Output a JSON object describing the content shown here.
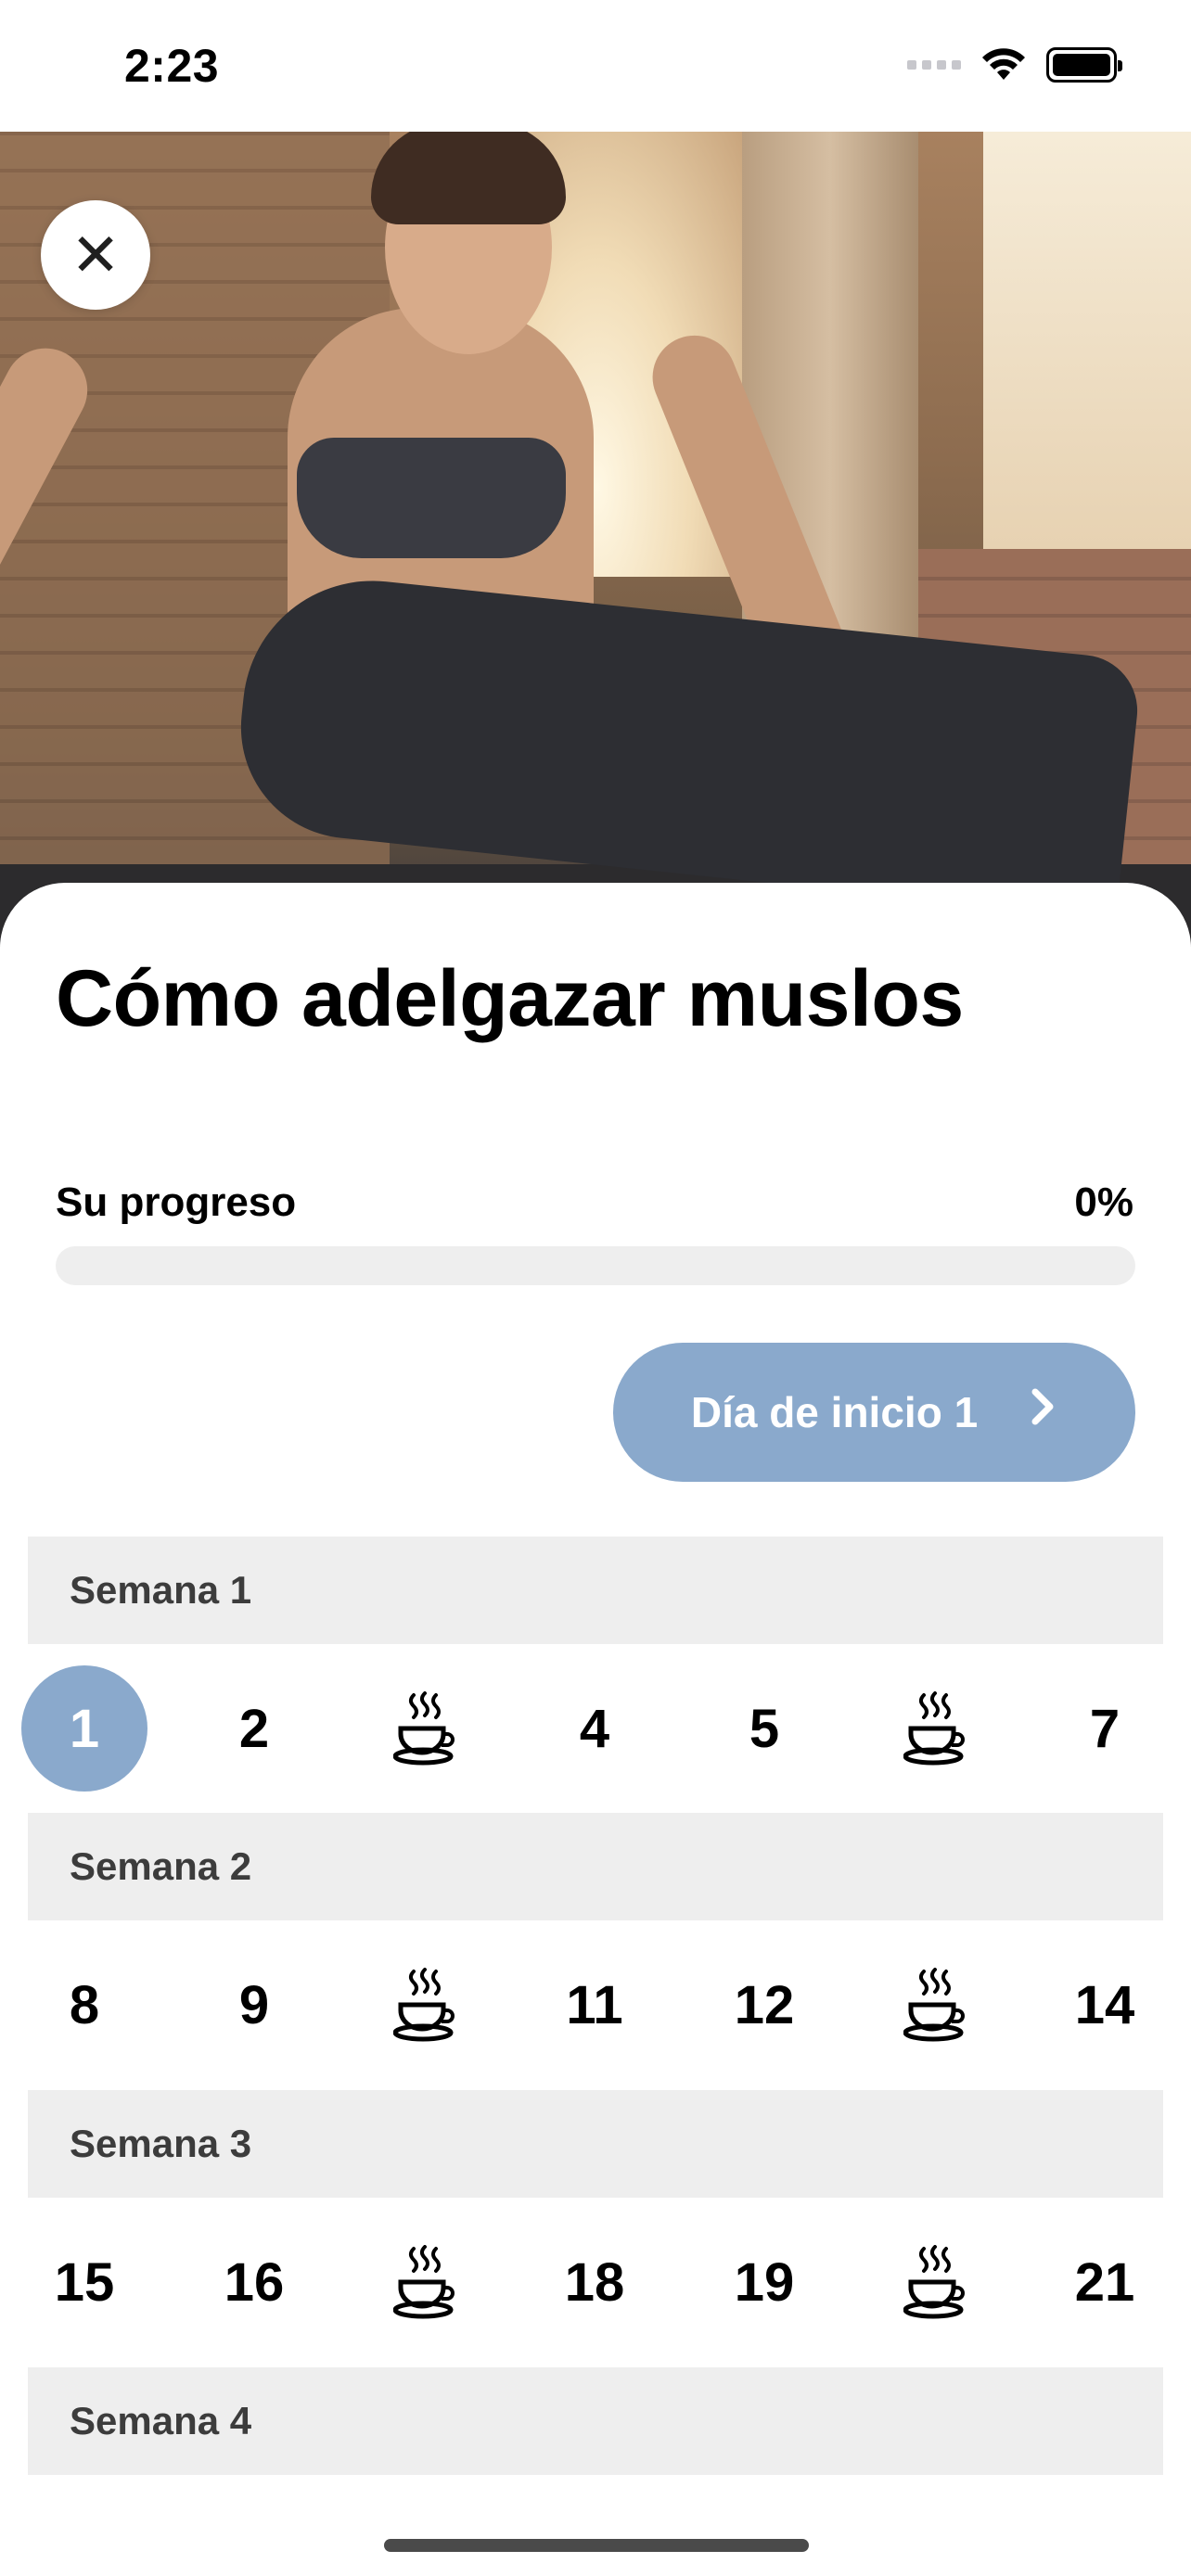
{
  "status_bar": {
    "time": "2:23"
  },
  "hero": {
    "close_glyph": "✕"
  },
  "program": {
    "title": "Cómo adelgazar muslos",
    "progress_label": "Su progreso",
    "progress_value": "0%",
    "progress_fraction": 0,
    "start_button_label": "Día de inicio 1",
    "start_button_icon": "chevron-right-icon"
  },
  "colors": {
    "accent": "#8aa9cc",
    "week_header_bg": "#eeeeee",
    "track": "#eeeeee"
  },
  "weeks": [
    {
      "label": "Semana 1",
      "days": [
        "1",
        "2",
        "rest",
        "4",
        "5",
        "rest",
        "7"
      ]
    },
    {
      "label": "Semana 2",
      "days": [
        "8",
        "9",
        "rest",
        "11",
        "12",
        "rest",
        "14"
      ]
    },
    {
      "label": "Semana 3",
      "days": [
        "15",
        "16",
        "rest",
        "18",
        "19",
        "rest",
        "21"
      ]
    },
    {
      "label": "Semana 4",
      "days": []
    }
  ],
  "current_day": "1",
  "rest_icon": "coffee-cup-icon"
}
